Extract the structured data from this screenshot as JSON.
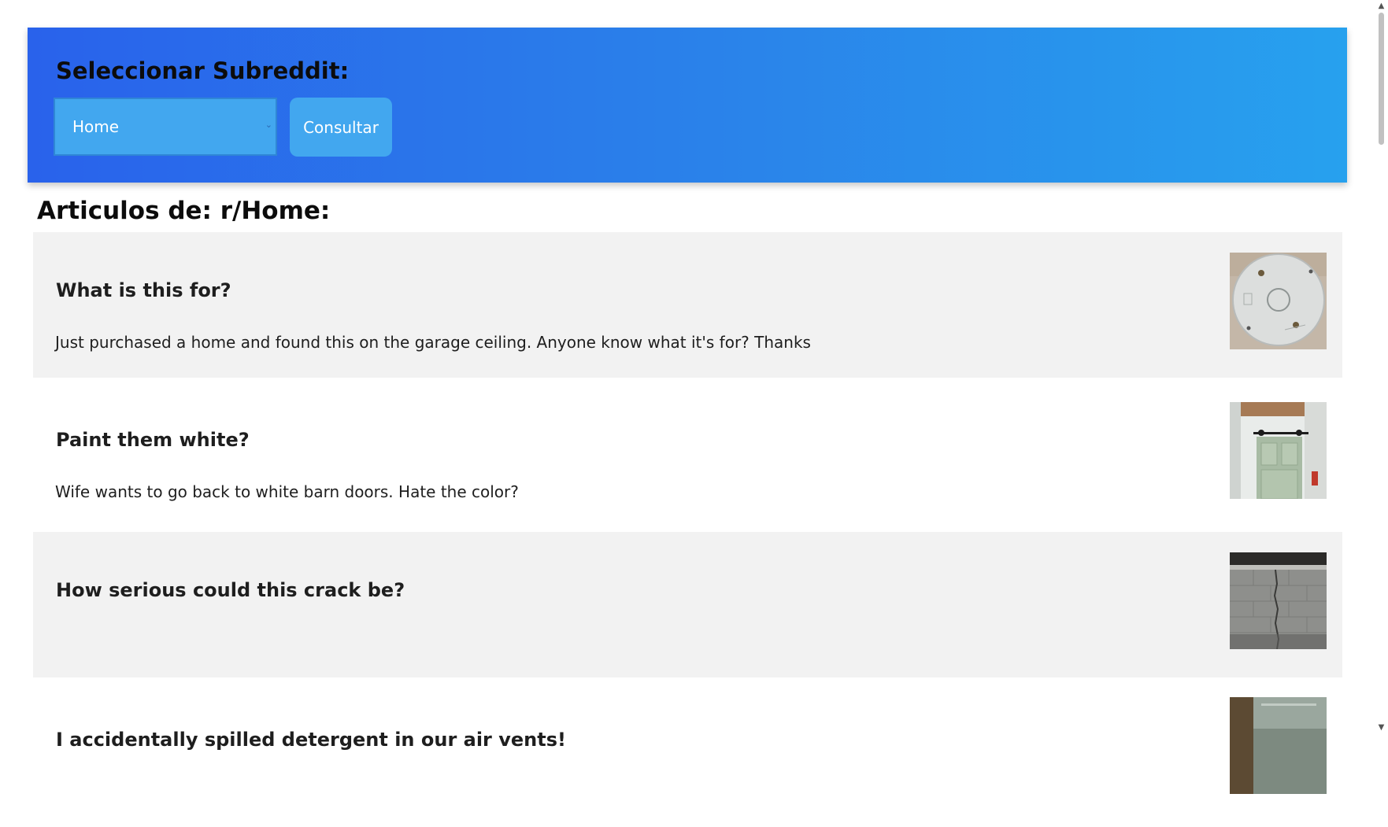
{
  "header": {
    "title": "Seleccionar Subreddit:",
    "select_value": "Home",
    "button_label": "Consultar"
  },
  "section_title": "Articulos de: r/Home:",
  "posts": [
    {
      "title": "What is this for?",
      "body": "Just purchased a home and found this on the garage ceiling. Anyone know what it's for? Thanks"
    },
    {
      "title": "Paint them white?",
      "body": "Wife wants to go back to white barn doors. Hate the color?"
    },
    {
      "title": "How serious could this crack be?",
      "body": ""
    },
    {
      "title": "I accidentally spilled detergent in our air vents!",
      "body": ""
    }
  ],
  "colors": {
    "header_gradient_start": "#2962eb",
    "header_gradient_end": "#27a1ee",
    "control_fill": "#42a7ef",
    "post_shaded": "#f2f2f2"
  }
}
